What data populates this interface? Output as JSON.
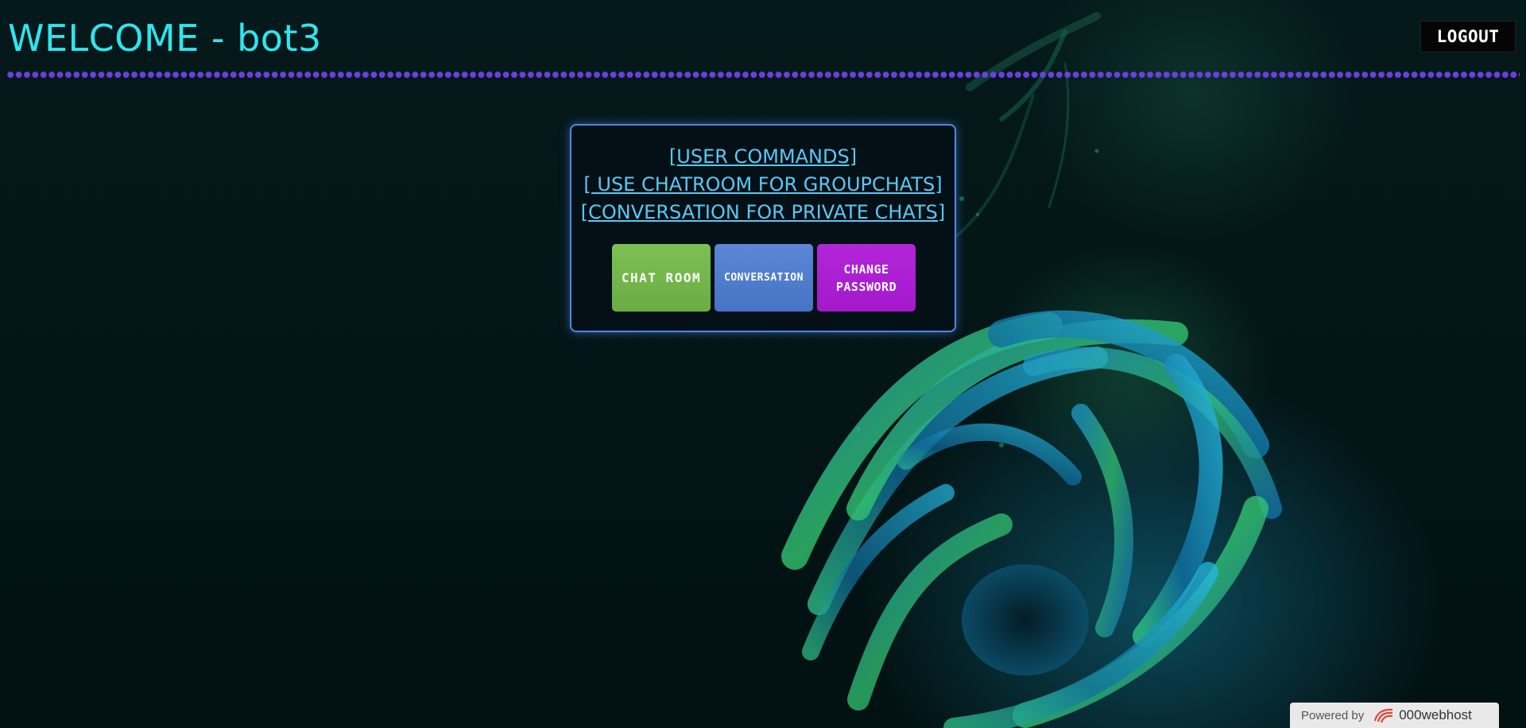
{
  "header": {
    "welcome_text": "WELCOME - bot3",
    "logout_label": "LOGOUT"
  },
  "panel": {
    "links": [
      "[USER COMMANDS]",
      "[ USE CHATROOM FOR GROUPCHATS]",
      "[CONVERSATION FOR PRIVATE CHATS]"
    ],
    "buttons": {
      "chat_room": "CHAT ROOM",
      "conversation": "CONVERSATION",
      "change_password": "CHANGE PASSWORD"
    }
  },
  "footer": {
    "powered_by": "Powered by",
    "brand": "000webhost"
  },
  "colors": {
    "welcome_text": "#2de6ee",
    "dot_divider": "#6b3fe0",
    "panel_border": "#4f86e6",
    "link": "#5ac8f5",
    "chat_room_button": "#74b64c",
    "conversation_button": "#507dcd",
    "change_password_button": "#ac20d2"
  }
}
